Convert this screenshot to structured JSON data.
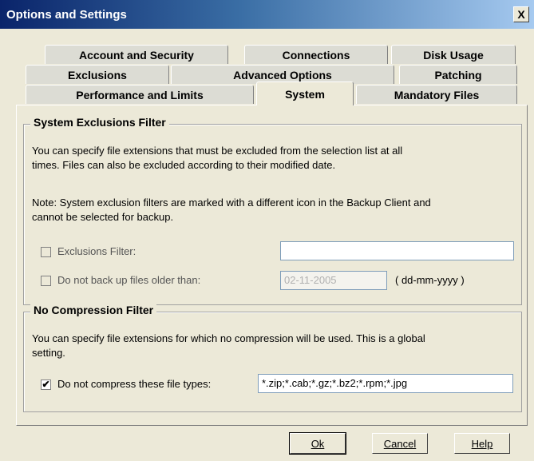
{
  "window": {
    "title": "Options and Settings",
    "close_glyph": "X"
  },
  "tabs": {
    "row1": [
      "Account and Security",
      "Connections",
      "Disk Usage"
    ],
    "row2": [
      "Exclusions",
      "Advanced Options",
      "Patching"
    ],
    "row3": [
      "Performance and Limits",
      "System",
      "Mandatory Files"
    ],
    "active": "System"
  },
  "system_exclusions": {
    "legend": "System Exclusions Filter",
    "description": "You can specify file extensions that must be excluded from the selection list at all times. Files can also be excluded according to their modified date.",
    "note": "Note: System exclusion filters are marked with a different icon in the Backup Client and cannot be selected for backup.",
    "exclusions_filter_label": "Exclusions Filter:",
    "exclusions_filter_value": "",
    "exclusions_filter_checked": false,
    "older_than_label": "Do not back up files older than:",
    "older_than_value": "02-11-2005",
    "older_than_checked": false,
    "date_format": "( dd-mm-yyyy )"
  },
  "no_compression": {
    "legend": "No Compression Filter",
    "description": "You can specify file extensions for which no compression will be used. This is a global setting.",
    "checkbox_label": "Do not compress these file types:",
    "checked": true,
    "value": "*.zip;*.cab;*.gz;*.bz2;*.rpm;*.jpg"
  },
  "buttons": {
    "ok": "Ok",
    "cancel": "Cancel",
    "help": "Help"
  }
}
